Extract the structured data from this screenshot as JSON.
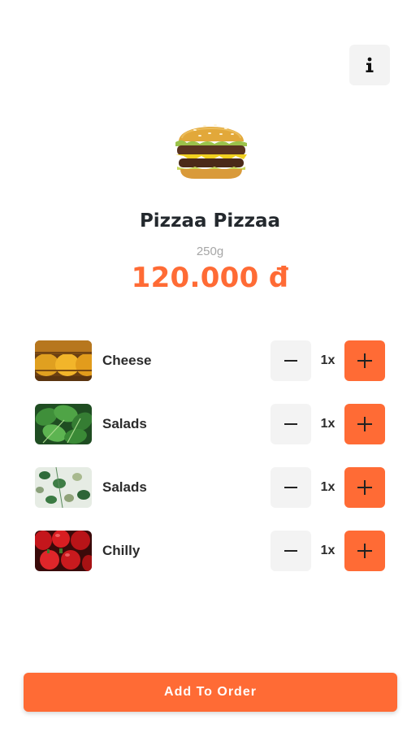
{
  "header": {
    "info_icon": "info-icon"
  },
  "product": {
    "image_icon": "burger-image",
    "name": "Pizzaa Pizzaa",
    "weight": "250g",
    "price": "120.000 đ"
  },
  "extras": [
    {
      "name": "Cheese",
      "qty": "1x",
      "thumb": "cheese-thumb"
    },
    {
      "name": "Salads",
      "qty": "1x",
      "thumb": "spinach-thumb"
    },
    {
      "name": "Salads",
      "qty": "1x",
      "thumb": "salad-leaves-thumb"
    },
    {
      "name": "Chilly",
      "qty": "1x",
      "thumb": "red-peppers-thumb"
    }
  ],
  "footer": {
    "add_label": "Add To Order"
  },
  "colors": {
    "accent": "#ff6b35",
    "button_bg": "#f3f3f3",
    "text_dark": "#24292e",
    "text_muted": "#a6a6a6"
  }
}
